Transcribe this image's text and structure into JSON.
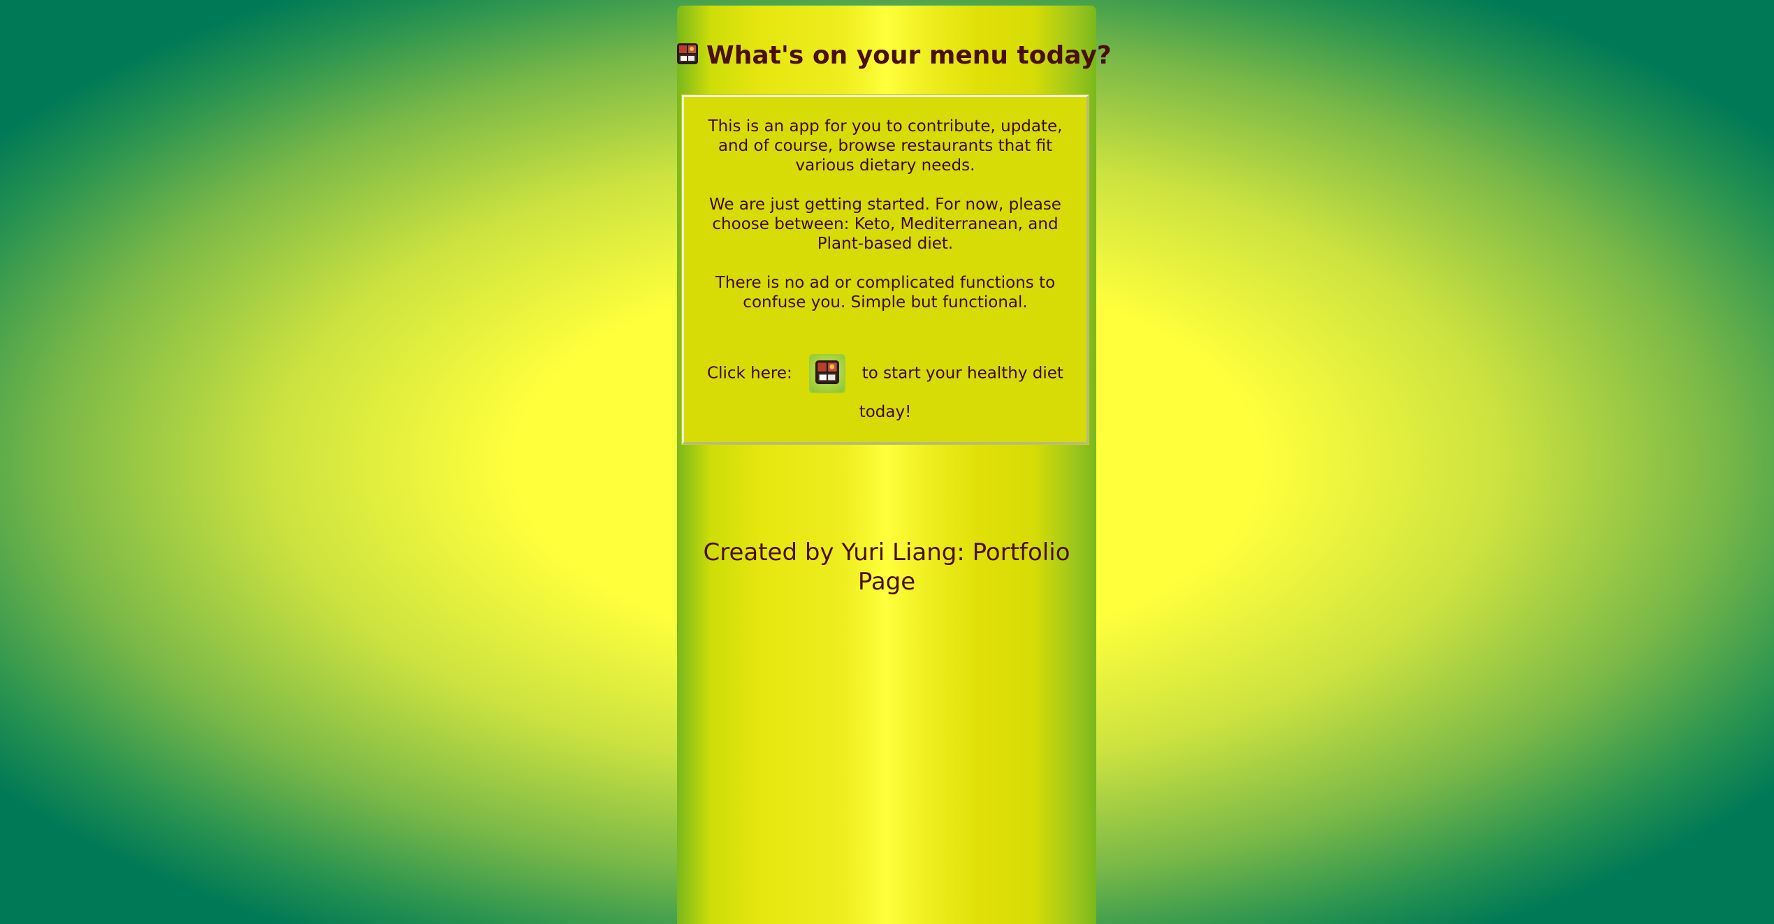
{
  "header": {
    "title": "What's on your menu today?",
    "title_icon": "bento-box-icon"
  },
  "intro": {
    "paragraph_1": "This is an app for you to contribute, update, and of course, browse restaurants that fit various dietary needs.",
    "paragraph_2": "We are just getting started. For now, please choose between: Keto, Mediterranean, and Plant-based diet.",
    "paragraph_3": "There is no ad or complicated functions to confuse you. Simple but functional."
  },
  "cta": {
    "prefix": "Click here:",
    "button_icon": "bento-box-icon",
    "suffix": "to start your healthy diet today!"
  },
  "footer": {
    "credit": "Created by Yuri Liang: Portfolio Page"
  },
  "colors": {
    "text_dark_maroon": "#4a0f08",
    "card_yellow": "#d7dc06",
    "column_green": "#79b81c",
    "background_yellow": "#ffff3c",
    "background_teal": "#007956"
  }
}
